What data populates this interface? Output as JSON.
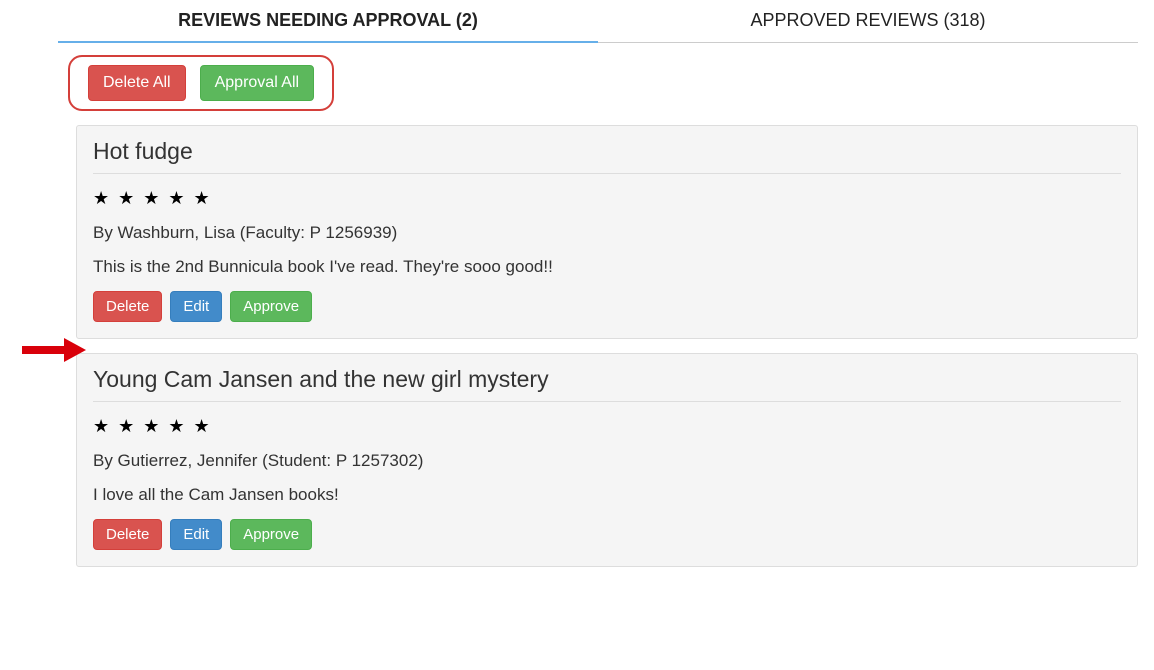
{
  "tabs": {
    "pending": "REVIEWS NEEDING APPROVAL (2)",
    "approved": "APPROVED REVIEWS (318)"
  },
  "bulk": {
    "delete_all": "Delete All",
    "approve_all": "Approval All"
  },
  "actions": {
    "delete": "Delete",
    "edit": "Edit",
    "approve": "Approve"
  },
  "reviews": [
    {
      "title": "Hot fudge",
      "stars": "★ ★ ★ ★ ★",
      "by": "By Washburn, Lisa (Faculty: P 1256939)",
      "body": "This is the 2nd Bunnicula book I've read. They're sooo good!!"
    },
    {
      "title": "Young Cam Jansen and the new girl mystery",
      "stars": "★ ★ ★ ★ ★",
      "by": "By Gutierrez, Jennifer (Student: P 1257302)",
      "body": "I love all the Cam Jansen books!"
    }
  ]
}
